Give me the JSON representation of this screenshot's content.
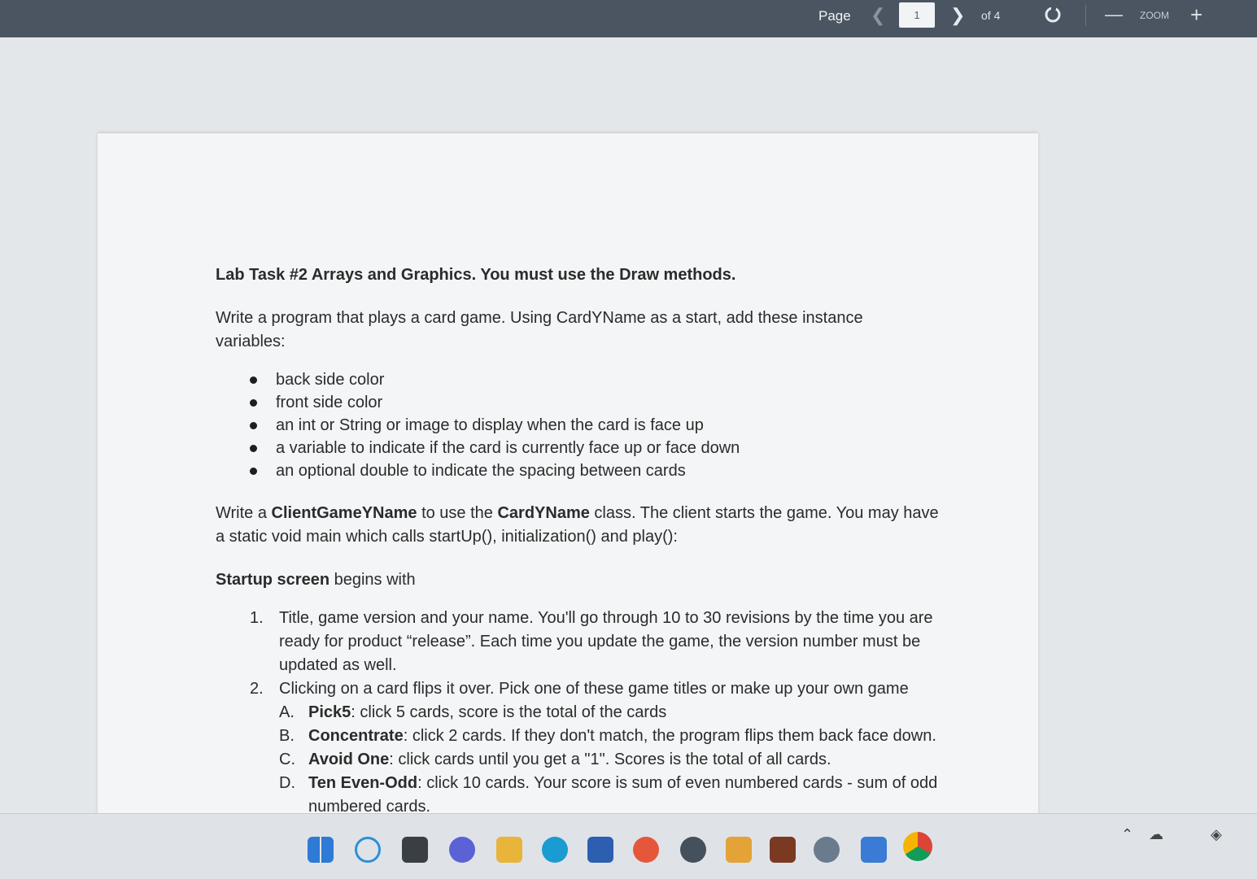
{
  "toolbar": {
    "page_label": "Page",
    "current_page": "1",
    "of_pages": "of 4",
    "zoom_label": "ZOOM"
  },
  "document": {
    "title": "Lab Task #2 Arrays and Graphics. You must use the Draw methods.",
    "intro": "Write a program that plays a card game. Using CardYName as a start, add these instance variables:",
    "bullets": [
      "back side color",
      "front side color",
      "an int or String or image to display when the card is face up",
      "a variable to indicate if the card is currently face up or face down",
      "an optional double to indicate the spacing between cards"
    ],
    "client_para": {
      "t1": "Write a ",
      "b1": "ClientGameYName",
      "t2": " to use the ",
      "b2": "CardYName",
      "t3": " class. The client starts the game. You may have a static void main which calls startUp(), initialization() and play():"
    },
    "startup": {
      "bold": "Startup screen",
      "rest": " begins with"
    },
    "steps": [
      {
        "num": "1.",
        "text": "Title, game version and your name. You'll go through 10 to 30 revisions by the time you are ready for product “release”. Each time you update the game, the version number must be updated as well."
      },
      {
        "num": "2.",
        "text": "Clicking on a card flips it over. Pick one of these game titles or make up your own game"
      }
    ],
    "games": [
      {
        "letter": "A.",
        "name": "Pick5",
        "desc": ": click 5 cards, score is the total of the cards"
      },
      {
        "letter": "B.",
        "name": "Concentrate",
        "desc": ": click 2 cards. If they don't match, the program flips them back face down."
      },
      {
        "letter": "C.",
        "name": "Avoid One",
        "desc": ": click cards until you get a \"1\". Scores is the total of all cards."
      },
      {
        "letter": "D.",
        "name": "Ten Even-Odd",
        "desc": ": click 10 cards. Your score is sum of even numbered cards - sum of odd numbered cards."
      }
    ]
  },
  "taskbar": {
    "icons": [
      "windows-start-icon",
      "search-icon",
      "task-view-icon",
      "meet-icon",
      "file-explorer-icon",
      "edge-icon",
      "store-icon",
      "firefox-icon",
      "app-icon",
      "snipping-icon",
      "image-app-icon",
      "settings-icon",
      "paint-icon",
      "chrome-icon"
    ]
  }
}
